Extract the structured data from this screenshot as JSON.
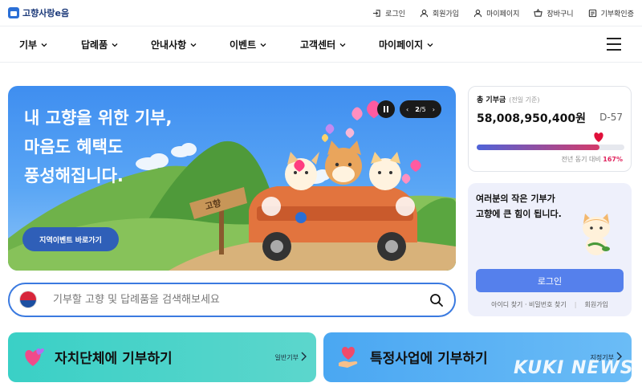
{
  "brand": {
    "logo_text": "고향사랑e음"
  },
  "util_nav": [
    {
      "label": "로그인",
      "icon": "login-icon"
    },
    {
      "label": "회원가입",
      "icon": "user-icon"
    },
    {
      "label": "마이페이지",
      "icon": "user-icon"
    },
    {
      "label": "장바구니",
      "icon": "basket-icon"
    },
    {
      "label": "기부확인증",
      "icon": "certificate-icon"
    }
  ],
  "main_nav": [
    {
      "label": "기부"
    },
    {
      "label": "답례품"
    },
    {
      "label": "안내사항"
    },
    {
      "label": "이벤트"
    },
    {
      "label": "고객센터"
    },
    {
      "label": "마이페이지"
    }
  ],
  "banner": {
    "title": "내 고향을 위한 기부,\n마음도 혜택도\n풍성해집니다.",
    "button": "지역이벤트 바로가기",
    "sign_text": "고향",
    "pager": {
      "prev": "‹",
      "current": "2",
      "sep": "/",
      "total": "5",
      "next": "›"
    }
  },
  "search": {
    "placeholder": "기부할 고향 및 답례품을 검색해보세요"
  },
  "cta": [
    {
      "title": "자치단체에 기부하기",
      "sub": "일반기부"
    },
    {
      "title": "특정사업에 기부하기",
      "sub": "지정기부"
    }
  ],
  "total": {
    "label": "총 기부금",
    "label_note": "(전일 기준)",
    "amount": "58,008,950,400원",
    "dday": "D-57",
    "progress_fraction": 0.83,
    "compare_label": "전년 동기 대비",
    "compare_value": "167%"
  },
  "login": {
    "message": "여러분의 작은 기부가\n고향에 큰 힘이 됩니다.",
    "button": "로그인",
    "find_link": "아이디 찾기 · 비밀번호 찾기",
    "signup_link": "회원가입"
  },
  "watermark": "KUKI NEWS",
  "colors": {
    "accent": "#5580ec",
    "banner_blue": "#3f8ef0",
    "teal": "#3ad0c6",
    "heart": "#e0245e"
  }
}
